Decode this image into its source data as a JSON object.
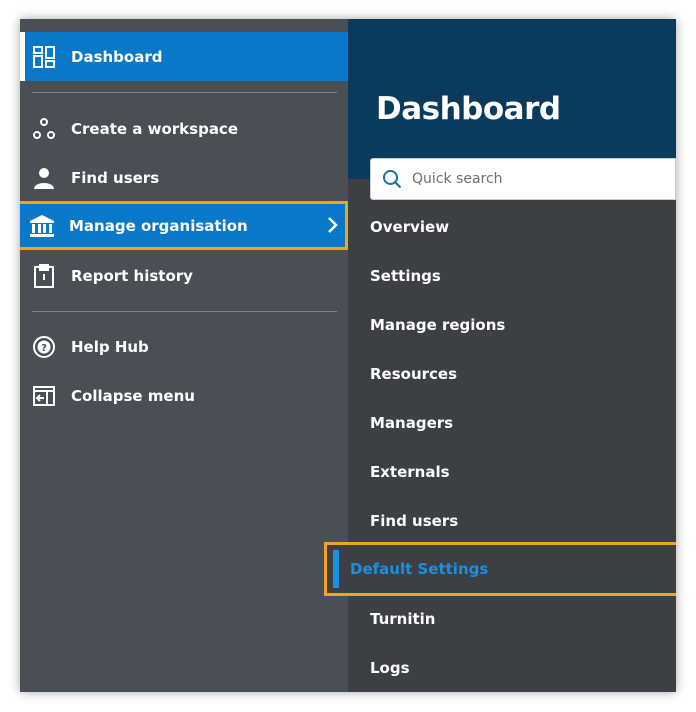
{
  "sidebar": {
    "dashboard_label": "Dashboard",
    "create_workspace_label": "Create a workspace",
    "find_users_label": "Find users",
    "manage_organisation_label": "Manage organisation",
    "report_history_label": "Report history",
    "help_hub_label": "Help Hub",
    "collapse_menu_label": "Collapse menu"
  },
  "submenu": {
    "title": "Dashboard",
    "search_placeholder": "Quick search",
    "items": [
      "Overview",
      "Settings",
      "Manage regions",
      "Resources",
      "Managers",
      "Externals",
      "Find users",
      "Default Settings",
      "Turnitin",
      "Logs"
    ]
  },
  "colors": {
    "sidebar_bg": "#4a4f55",
    "submenu_bg": "#3c3f44",
    "header_bg": "#0a3a5c",
    "accent_blue": "#0a78c8",
    "highlight_outline": "#f1a41c",
    "selected_text": "#1b8fe0"
  },
  "icons": {
    "dashboard": "dashboard-grid-icon",
    "create_workspace": "workspace-nodes-icon",
    "find_users": "user-icon",
    "manage_organisation": "institution-icon",
    "report_history": "clipboard-icon",
    "help_hub": "help-circle-icon",
    "collapse_menu": "collapse-menu-icon",
    "search": "search-icon",
    "chevron": "chevron-right-icon"
  }
}
